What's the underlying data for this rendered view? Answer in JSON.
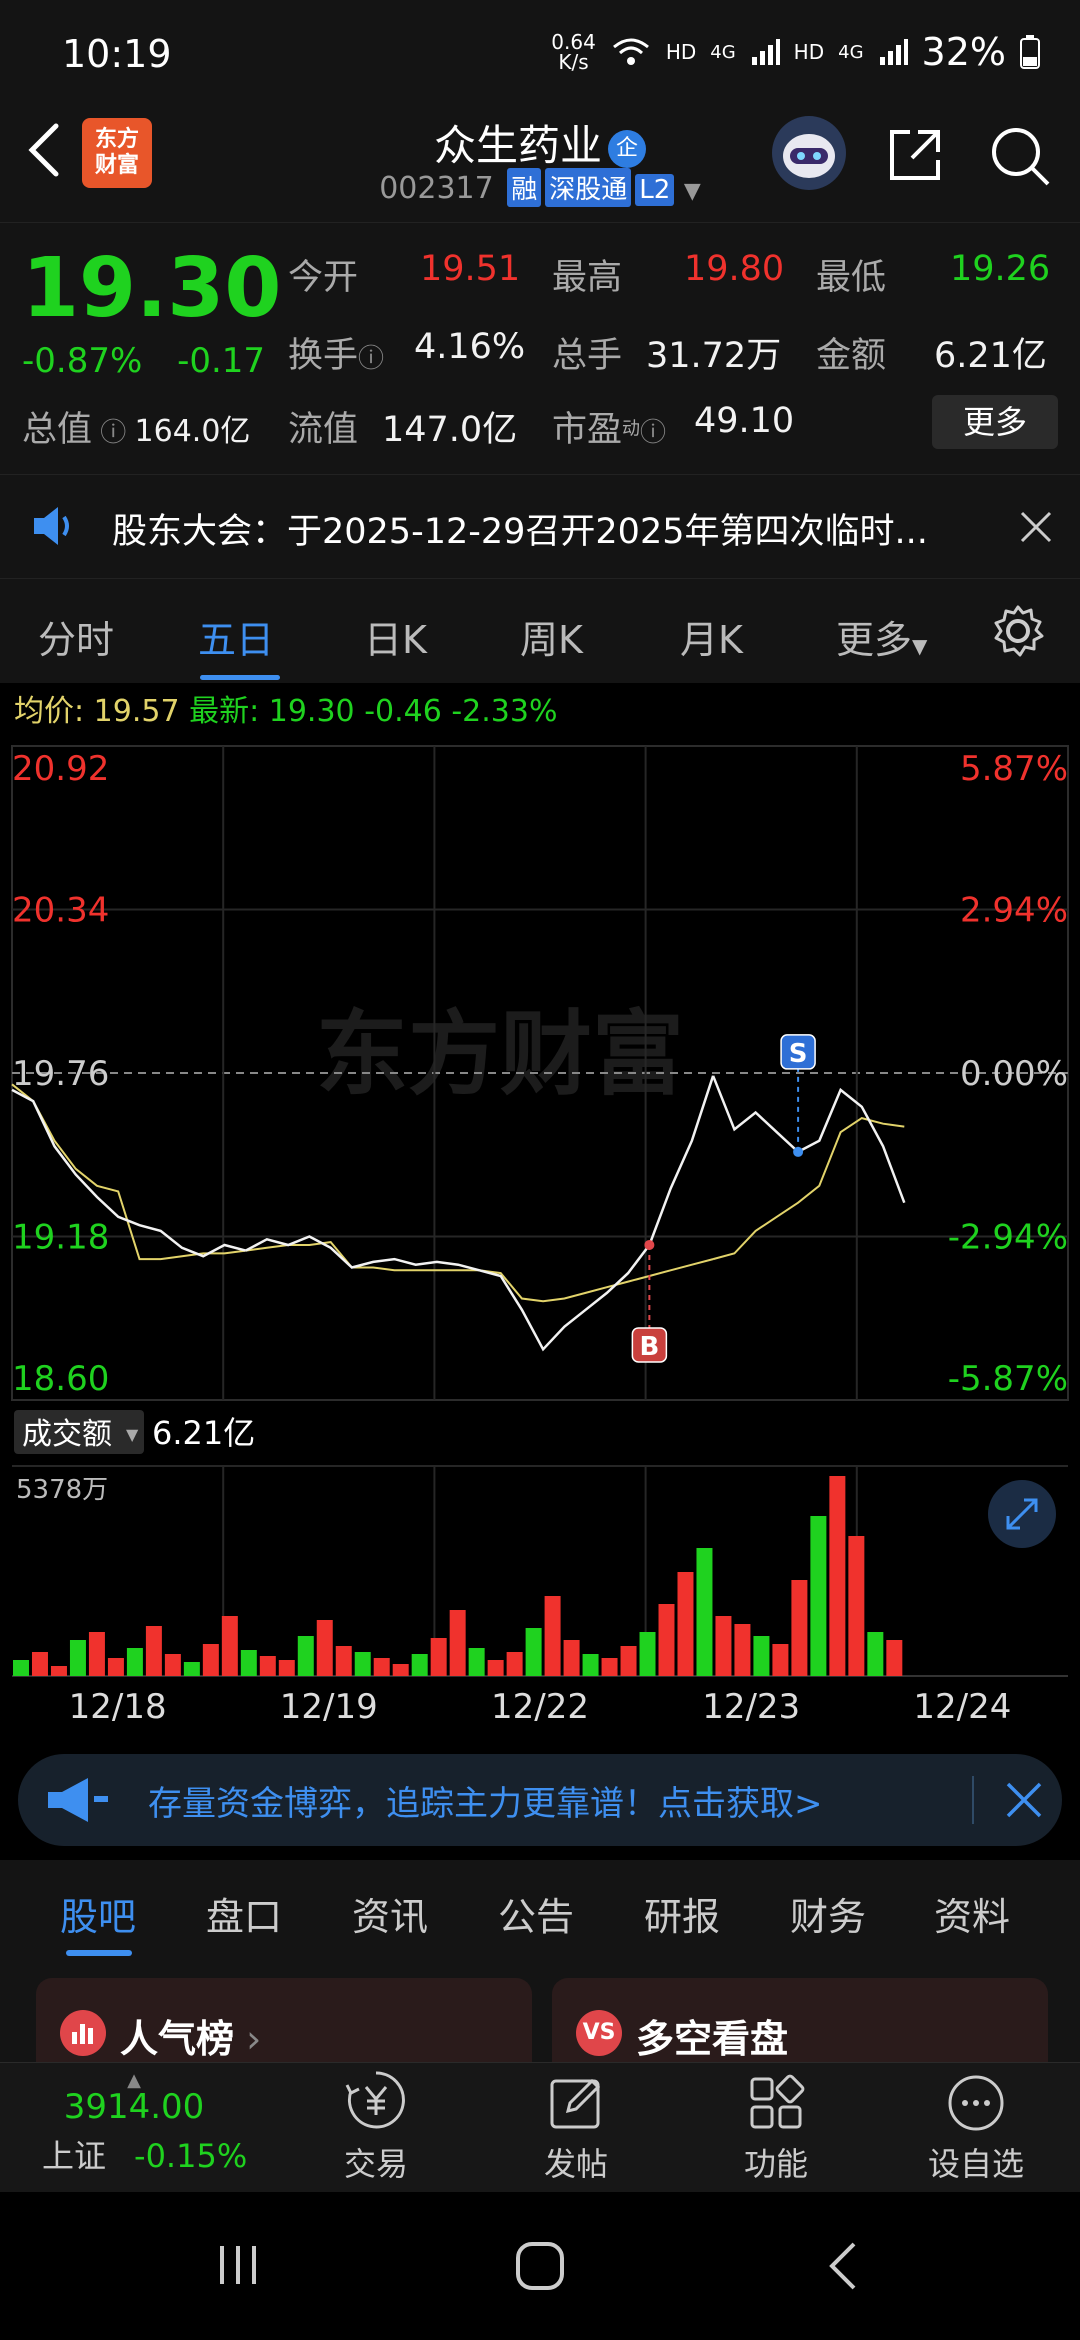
{
  "status_bar": {
    "time": "10:19",
    "net_speed_top": "0.64",
    "net_speed_bottom": "K/s",
    "battery": "32%",
    "hd1": "HD",
    "hd2": "HD",
    "sig1": "4G",
    "sig2": "4G"
  },
  "header": {
    "logo_line1": "东方",
    "logo_line2": "财富",
    "stock_name": "众生药业",
    "badge": "企",
    "code": "002317",
    "tags": [
      "融",
      "深股通",
      "L2"
    ]
  },
  "quote": {
    "price": "19.30",
    "change_pct": "-0.87%",
    "change_abs": "-0.17",
    "open_label": "今开",
    "open": "19.51",
    "high_label": "最高",
    "high": "19.80",
    "low_label": "最低",
    "low": "19.26",
    "turnover_label": "换手",
    "turnover": "4.16%",
    "volume_label": "总手",
    "volume": "31.72万",
    "amount_label": "金额",
    "amount": "6.21亿",
    "mktcap_label": "总值",
    "mktcap": "164.0亿",
    "float_label": "流值",
    "float": "147.0亿",
    "pe_label": "市盈",
    "pe_sup": "动",
    "pe": "49.10",
    "more": "更多"
  },
  "notice": {
    "text": "股东大会：于2025-12-29召开2025年第四次临时..."
  },
  "tabs": {
    "items": [
      "分时",
      "五日",
      "日K",
      "周K",
      "月K",
      "更多"
    ]
  },
  "avg_row": {
    "avg_label": "均价:",
    "avg": "19.57",
    "latest_label": "最新:",
    "latest": "19.30",
    "chg": "-0.46",
    "pct": "-2.33%"
  },
  "chart_data": {
    "type": "line",
    "title": "",
    "y_left": [
      "20.92",
      "20.34",
      "19.76",
      "19.18",
      "18.60"
    ],
    "y_right": [
      "5.87%",
      "2.94%",
      "0.00%",
      "-2.94%",
      "-5.87%"
    ],
    "x": [
      "12/18",
      "12/19",
      "12/22",
      "12/23",
      "12/24"
    ],
    "ylim": [
      18.6,
      20.92
    ],
    "prev_close": 19.76,
    "series": [
      {
        "values": [
          19.7,
          19.66,
          19.5,
          19.4,
          19.32,
          19.25,
          19.22,
          19.2,
          19.14,
          19.11,
          19.15,
          19.13,
          19.17,
          19.15,
          19.18,
          19.14,
          19.07,
          19.09,
          19.1,
          19.08,
          19.09,
          19.08,
          19.06,
          19.04,
          18.92,
          18.78,
          18.86,
          18.92,
          18.98,
          19.05,
          19.15,
          19.35,
          19.52,
          19.75,
          19.56,
          19.62,
          19.55,
          19.48,
          19.52,
          19.7,
          19.64,
          19.5,
          19.3
        ]
      },
      {
        "values": [
          19.72,
          19.66,
          19.52,
          19.42,
          19.36,
          19.34,
          19.1,
          19.1,
          19.11,
          19.12,
          19.12,
          19.13,
          19.14,
          19.15,
          19.15,
          19.16,
          19.07,
          19.07,
          19.06,
          19.06,
          19.06,
          19.06,
          19.06,
          19.05,
          18.96,
          18.95,
          18.96,
          18.98,
          19.0,
          19.02,
          19.04,
          19.06,
          19.08,
          19.1,
          19.12,
          19.2,
          19.25,
          19.3,
          19.36,
          19.55,
          19.6,
          19.58,
          19.57
        ]
      }
    ],
    "markers": [
      {
        "label": "S",
        "x_index": 37
      },
      {
        "label": "B",
        "x_index": 30
      }
    ],
    "volume_label": "成交额",
    "volume_value": "6.21亿",
    "volume_max": "5378万",
    "volume_values": [
      8,
      12,
      5,
      18,
      22,
      9,
      14,
      25,
      11,
      7,
      16,
      30,
      13,
      10,
      8,
      20,
      28,
      15,
      12,
      9,
      6,
      11,
      19,
      33,
      14,
      8,
      12,
      24,
      40,
      18,
      11,
      9,
      15,
      22,
      36,
      52,
      64,
      30,
      26,
      20,
      16,
      48,
      80,
      100,
      70,
      22,
      18
    ]
  },
  "banner": {
    "text": "存量资金博弈，追踪主力更靠谱！点击获取>"
  },
  "bottom_tabs": {
    "items": [
      "股吧",
      "盘口",
      "资讯",
      "公告",
      "研报",
      "财务",
      "资料"
    ]
  },
  "cards": {
    "left": "人气榜",
    "right": "多空看盘"
  },
  "footer": {
    "index_value": "3914.00",
    "index_name": "上证",
    "index_pct": "-0.15%",
    "items": [
      "交易",
      "发帖",
      "功能",
      "设自选"
    ]
  },
  "watermark": "东方财富",
  "colors": {
    "up": "#f0322d",
    "down": "#1fd21f",
    "accent": "#3e8ff0",
    "avg_line": "#e2d36a"
  }
}
